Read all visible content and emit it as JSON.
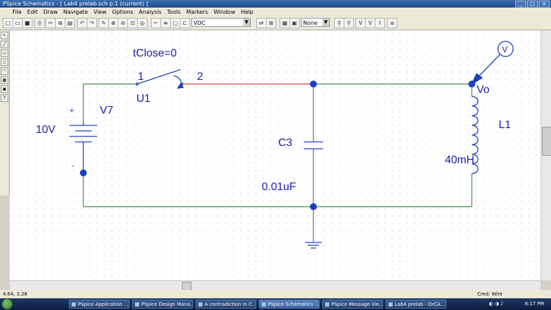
{
  "window": {
    "title": "PSpice Schematics - [ Lab4 prelab.sch  p.1 (current) ]",
    "controls": [
      "_",
      "□",
      "✕"
    ]
  },
  "menu": [
    "File",
    "Edit",
    "Draw",
    "Navigate",
    "View",
    "Options",
    "Analysis",
    "Tools",
    "Markers",
    "Window",
    "Help"
  ],
  "toolbar": {
    "part_combo": "VDC",
    "zoom_combo": "None",
    "icons": [
      "new-icon",
      "open-icon",
      "save-icon",
      "print-icon",
      "cut-icon",
      "copy-icon",
      "paste-icon",
      "undo-icon",
      "redo-icon",
      "draw-wire-icon",
      "zoom-in-icon",
      "zoom-out-icon",
      "zoom-area-icon",
      "zoom-fit-icon",
      "redraw-icon",
      "wire-icon",
      "bus-icon",
      "block-icon",
      "part-icon",
      "attribute-icon",
      "setup-icon",
      "simulate-icon",
      "voltage-marker-icon",
      "current-marker-icon",
      "probe-icon"
    ]
  },
  "schematic": {
    "switch": {
      "ref": "U1",
      "param": "tClose=0",
      "pin1": "1",
      "pin2": "2"
    },
    "source": {
      "ref": "V7",
      "value": "10V",
      "plus": "+",
      "minus": "-"
    },
    "capacitor": {
      "ref": "C3",
      "value": "0.01uF"
    },
    "inductor": {
      "ref": "L1",
      "value": "40mH"
    },
    "node_label": "Vo",
    "marker_label": "V",
    "wire_color": "#3c8a3c",
    "selected_wire_color": "#c83c3c",
    "component_color": "#1a3fbf",
    "text_color": "#1a1aa8"
  },
  "status": {
    "coords": "4.64,  3.28",
    "cmd": "Cmd: Wire"
  },
  "taskbar": {
    "tasks": [
      "PSpice Application ...",
      "PSpice Design Mana...",
      "A contradiction in C...",
      "PSpice Schematics -...",
      "PSpice Message Vie...",
      "Lab4 prelab - OrCA..."
    ],
    "clock": "8:17 PM"
  }
}
